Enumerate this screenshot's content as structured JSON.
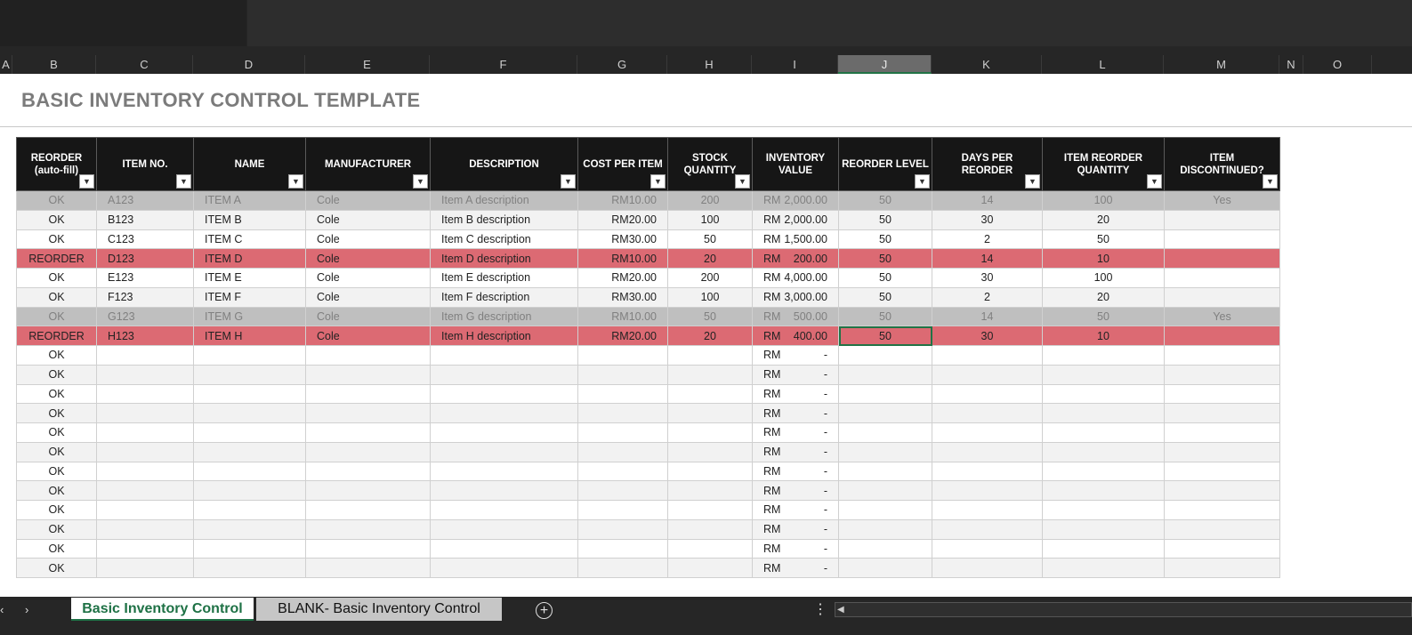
{
  "title": "BASIC INVENTORY CONTROL TEMPLATE",
  "column_letters": [
    "A",
    "B",
    "C",
    "D",
    "E",
    "F",
    "G",
    "H",
    "I",
    "J",
    "K",
    "L",
    "M",
    "N",
    "O"
  ],
  "selected_column": "J",
  "headers": [
    "REORDER (auto-fill)",
    "ITEM NO.",
    "NAME",
    "MANUFACTURER",
    "DESCRIPTION",
    "COST PER ITEM",
    "STOCK QUANTITY",
    "INVENTORY VALUE",
    "REORDER LEVEL",
    "DAYS PER REORDER",
    "ITEM REORDER QUANTITY",
    "ITEM DISCONTINUED?"
  ],
  "filter_icon": "dropdown-arrow-icon",
  "currency": "RM",
  "rows": [
    {
      "status": "OK",
      "item_no": "A123",
      "name": "ITEM A",
      "manufacturer": "Cole",
      "description": "Item A description",
      "cost": "RM10.00",
      "stock": "200",
      "inv_amount": "2,000.00",
      "reorder_level": "50",
      "days": "14",
      "reorder_qty": "100",
      "discontinued": "Yes",
      "style": "disc"
    },
    {
      "status": "OK",
      "item_no": "B123",
      "name": "ITEM B",
      "manufacturer": "Cole",
      "description": "Item B description",
      "cost": "RM20.00",
      "stock": "100",
      "inv_amount": "2,000.00",
      "reorder_level": "50",
      "days": "30",
      "reorder_qty": "20",
      "discontinued": "",
      "style": "even"
    },
    {
      "status": "OK",
      "item_no": "C123",
      "name": "ITEM C",
      "manufacturer": "Cole",
      "description": "Item C description",
      "cost": "RM30.00",
      "stock": "50",
      "inv_amount": "1,500.00",
      "reorder_level": "50",
      "days": "2",
      "reorder_qty": "50",
      "discontinued": "",
      "style": "odd"
    },
    {
      "status": "REORDER",
      "item_no": "D123",
      "name": "ITEM D",
      "manufacturer": "Cole",
      "description": "Item D description",
      "cost": "RM10.00",
      "stock": "20",
      "inv_amount": "200.00",
      "reorder_level": "50",
      "days": "14",
      "reorder_qty": "10",
      "discontinued": "",
      "style": "reorder"
    },
    {
      "status": "OK",
      "item_no": "E123",
      "name": "ITEM E",
      "manufacturer": "Cole",
      "description": "Item E description",
      "cost": "RM20.00",
      "stock": "200",
      "inv_amount": "4,000.00",
      "reorder_level": "50",
      "days": "30",
      "reorder_qty": "100",
      "discontinued": "",
      "style": "odd"
    },
    {
      "status": "OK",
      "item_no": "F123",
      "name": "ITEM F",
      "manufacturer": "Cole",
      "description": "Item F description",
      "cost": "RM30.00",
      "stock": "100",
      "inv_amount": "3,000.00",
      "reorder_level": "50",
      "days": "2",
      "reorder_qty": "20",
      "discontinued": "",
      "style": "even"
    },
    {
      "status": "OK",
      "item_no": "G123",
      "name": "ITEM G",
      "manufacturer": "Cole",
      "description": "Item G description",
      "cost": "RM10.00",
      "stock": "50",
      "inv_amount": "500.00",
      "reorder_level": "50",
      "days": "14",
      "reorder_qty": "50",
      "discontinued": "Yes",
      "style": "disc"
    },
    {
      "status": "REORDER",
      "item_no": "H123",
      "name": "ITEM H",
      "manufacturer": "Cole",
      "description": "Item H description",
      "cost": "RM20.00",
      "stock": "20",
      "inv_amount": "400.00",
      "reorder_level": "50",
      "days": "30",
      "reorder_qty": "10",
      "discontinued": "",
      "style": "reorder",
      "active_col": "reorder_level"
    },
    {
      "status": "OK",
      "item_no": "",
      "name": "",
      "manufacturer": "",
      "description": "",
      "cost": "",
      "stock": "",
      "inv_amount": "-",
      "reorder_level": "",
      "days": "",
      "reorder_qty": "",
      "discontinued": "",
      "style": "odd"
    },
    {
      "status": "OK",
      "item_no": "",
      "name": "",
      "manufacturer": "",
      "description": "",
      "cost": "",
      "stock": "",
      "inv_amount": "-",
      "reorder_level": "",
      "days": "",
      "reorder_qty": "",
      "discontinued": "",
      "style": "even"
    },
    {
      "status": "OK",
      "item_no": "",
      "name": "",
      "manufacturer": "",
      "description": "",
      "cost": "",
      "stock": "",
      "inv_amount": "-",
      "reorder_level": "",
      "days": "",
      "reorder_qty": "",
      "discontinued": "",
      "style": "odd"
    },
    {
      "status": "OK",
      "item_no": "",
      "name": "",
      "manufacturer": "",
      "description": "",
      "cost": "",
      "stock": "",
      "inv_amount": "-",
      "reorder_level": "",
      "days": "",
      "reorder_qty": "",
      "discontinued": "",
      "style": "even"
    },
    {
      "status": "OK",
      "item_no": "",
      "name": "",
      "manufacturer": "",
      "description": "",
      "cost": "",
      "stock": "",
      "inv_amount": "-",
      "reorder_level": "",
      "days": "",
      "reorder_qty": "",
      "discontinued": "",
      "style": "odd"
    },
    {
      "status": "OK",
      "item_no": "",
      "name": "",
      "manufacturer": "",
      "description": "",
      "cost": "",
      "stock": "",
      "inv_amount": "-",
      "reorder_level": "",
      "days": "",
      "reorder_qty": "",
      "discontinued": "",
      "style": "even"
    },
    {
      "status": "OK",
      "item_no": "",
      "name": "",
      "manufacturer": "",
      "description": "",
      "cost": "",
      "stock": "",
      "inv_amount": "-",
      "reorder_level": "",
      "days": "",
      "reorder_qty": "",
      "discontinued": "",
      "style": "odd"
    },
    {
      "status": "OK",
      "item_no": "",
      "name": "",
      "manufacturer": "",
      "description": "",
      "cost": "",
      "stock": "",
      "inv_amount": "-",
      "reorder_level": "",
      "days": "",
      "reorder_qty": "",
      "discontinued": "",
      "style": "even"
    },
    {
      "status": "OK",
      "item_no": "",
      "name": "",
      "manufacturer": "",
      "description": "",
      "cost": "",
      "stock": "",
      "inv_amount": "-",
      "reorder_level": "",
      "days": "",
      "reorder_qty": "",
      "discontinued": "",
      "style": "odd"
    },
    {
      "status": "OK",
      "item_no": "",
      "name": "",
      "manufacturer": "",
      "description": "",
      "cost": "",
      "stock": "",
      "inv_amount": "-",
      "reorder_level": "",
      "days": "",
      "reorder_qty": "",
      "discontinued": "",
      "style": "even"
    },
    {
      "status": "OK",
      "item_no": "",
      "name": "",
      "manufacturer": "",
      "description": "",
      "cost": "",
      "stock": "",
      "inv_amount": "-",
      "reorder_level": "",
      "days": "",
      "reorder_qty": "",
      "discontinued": "",
      "style": "odd"
    },
    {
      "status": "OK",
      "item_no": "",
      "name": "",
      "manufacturer": "",
      "description": "",
      "cost": "",
      "stock": "",
      "inv_amount": "-",
      "reorder_level": "",
      "days": "",
      "reorder_qty": "",
      "discontinued": "",
      "style": "even"
    }
  ],
  "sheet_tabs": {
    "active": "Basic Inventory Control",
    "other": "BLANK- Basic Inventory Control"
  },
  "colors": {
    "reorder_row": "#dc6a73",
    "discontinued_row": "#bfbfbf",
    "header_bg": "#161616",
    "active_tab_text": "#1e7145",
    "title_text": "#7b7b7b"
  }
}
